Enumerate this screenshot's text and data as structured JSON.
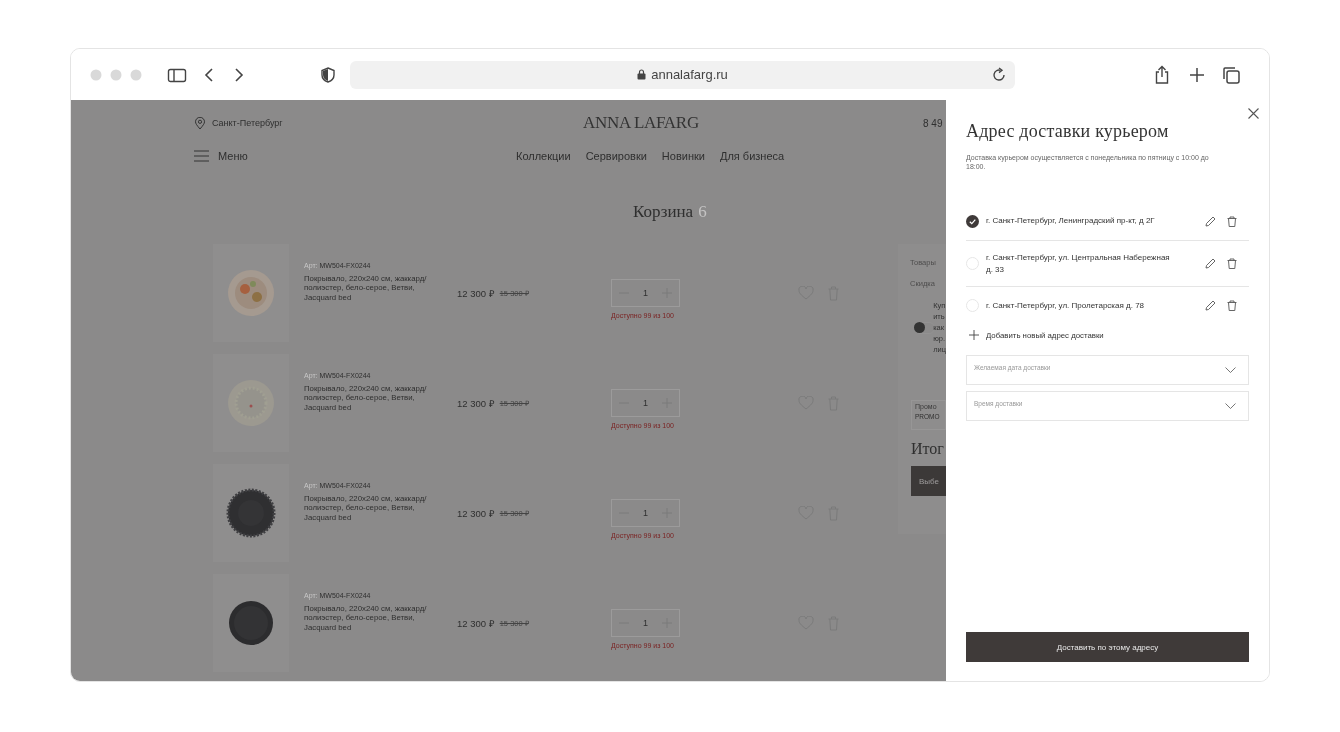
{
  "browser": {
    "url": "annalafarg.ru"
  },
  "header": {
    "city": "Санкт-Петербург",
    "logo": "ANNA LAFARG",
    "phone": "8 49",
    "menu_label": "Меню",
    "nav": [
      "Коллекции",
      "Сервировки",
      "Новинки",
      "Для бизнеса"
    ]
  },
  "cart": {
    "title": "Корзина",
    "count": "6",
    "items": [
      {
        "article_label": "Арт:",
        "article": "MW504-FX0244",
        "name": "Покрывало, 220x240 см, жаккард/ полиэстер, бело-серое, Ветви, Jacquard bed",
        "price": "12 300 ₽",
        "old_price": "15 300 ₽",
        "quantity": "1",
        "availability": "Доступно 99 из 100"
      },
      {
        "article_label": "Арт:",
        "article": "MW504-FX0244",
        "name": "Покрывало, 220x240 см, жаккард/ полиэстер, бело-серое, Ветви, Jacquard bed",
        "price": "12 300 ₽",
        "old_price": "15 300 ₽",
        "quantity": "1",
        "availability": "Доступно 99 из 100"
      },
      {
        "article_label": "Арт:",
        "article": "MW504-FX0244",
        "name": "Покрывало, 220x240 см, жаккард/ полиэстер, бело-серое, Ветви, Jacquard bed",
        "price": "12 300 ₽",
        "old_price": "15 300 ₽",
        "quantity": "1",
        "availability": "Доступно 99 из 100"
      },
      {
        "article_label": "Арт:",
        "article": "MW504-FX0244",
        "name": "Покрывало, 220x240 см, жаккард/ полиэстер, бело-серое, Ветви, Jacquard bed",
        "price": "12 300 ₽",
        "old_price": "15 300 ₽",
        "quantity": "1",
        "availability": "Доступно 99 из 100"
      }
    ]
  },
  "summary": {
    "goods_label": "Товары",
    "discount_label": "Скидка",
    "coupon_lines": [
      "Куп",
      "ить",
      "как",
      "юр.",
      "лиц"
    ],
    "legal_toggle": {
      "on": false
    },
    "promo_label": "Промо",
    "promo_value": "PROMO",
    "total_label": "Итог",
    "checkout_button": "Выбе"
  },
  "drawer": {
    "title": "Адрес доставки курьером",
    "note": "Доставка курьером осуществляется с понедельника по пятницу с 10:00 до 18:00.",
    "addresses": [
      {
        "text": "г. Санкт-Петербург, Ленинградский пр-кт, д 2Г",
        "selected": true
      },
      {
        "text": "г. Санкт-Петербург, ул. Центральная Набережная д. 33",
        "selected": false
      },
      {
        "text": "г. Санкт-Петербург, ул. Пролетарская д. 78",
        "selected": false
      }
    ],
    "add_label": "Добавить новый адрес доставки",
    "selects": [
      {
        "placeholder": "Желаемая дата доставки"
      },
      {
        "placeholder": "Время доставки"
      }
    ],
    "submit": "Доставить по этому адресу"
  }
}
